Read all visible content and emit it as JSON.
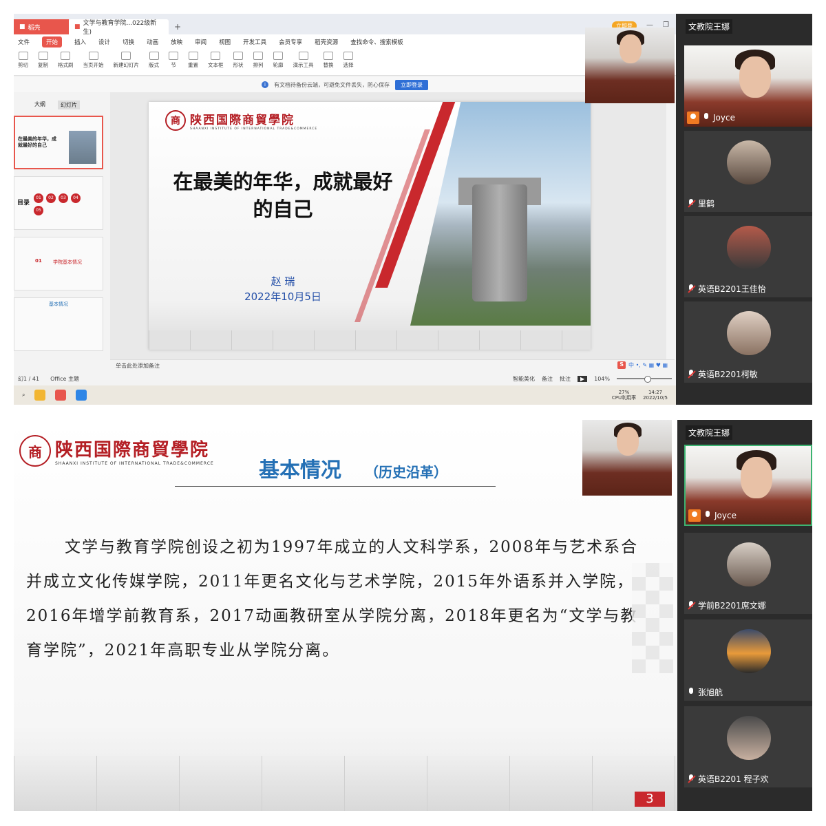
{
  "shot1": {
    "tabs": [
      {
        "label": "稻壳"
      },
      {
        "label": "文学与教育学院...022级新生)"
      }
    ],
    "tab_plus": "+",
    "login_pill": "立即登",
    "menu": [
      "文件",
      "开始",
      "插入",
      "设计",
      "切换",
      "动画",
      "放映",
      "审阅",
      "视图",
      "开发工具",
      "会员专享",
      "稻壳资源",
      "查找命令、搜索模板"
    ],
    "menu_active": "开始",
    "ribbon": [
      "剪切",
      "复制",
      "格式刷",
      "当页开始",
      "新建幻灯片",
      "版式",
      "节",
      "重置",
      "文本框",
      "形状",
      "排列",
      "轮廓",
      "演示工具",
      "替换",
      "选择"
    ],
    "infobar": {
      "text": "有文档待备份云端，可避免文件丢失，防心保存",
      "button": "立即登录"
    },
    "left_tabs": {
      "outline": "大纲",
      "slides": "幻灯片"
    },
    "thumbs": {
      "t1": "在最美的年华，成就最好的自己",
      "t2": "目录",
      "t2_items": [
        "01",
        "02",
        "03",
        "04",
        "05"
      ],
      "t3_num": "01",
      "t3": "学院基本情况",
      "t4": "基本情况"
    },
    "add_slide": "+",
    "slide": {
      "logo_seal": "商",
      "logo_cn": "陕西国際商貿學院",
      "logo_en": "SHAANXI INSTITUTE OF INTERNATIONAL TRADE&COMMERCE",
      "title": "在最美的年华，成就最好的自己",
      "author": "赵 瑞",
      "date": "2022年10月5日"
    },
    "notes": "单击此处添加备注",
    "ime": {
      "s": "S",
      "text": "中 •, ✎ ▦ ♥ ▦"
    },
    "status": {
      "page": "幻1 / 41",
      "theme": "Office 主题",
      "beautify": "智能美化",
      "notes": "备注",
      "comments": "批注",
      "zoom": "104%"
    },
    "tray": {
      "cpu": "27%",
      "cpu_label": "CPU利用率",
      "time": "14:27",
      "date": "2022/10/5"
    },
    "side_title": "文教院王娜",
    "participants": [
      {
        "name": "Joyce",
        "muted": false
      },
      {
        "name": "里鹤",
        "muted": true
      },
      {
        "name": "英语B2201王佳怡",
        "muted": true
      },
      {
        "name": "英语B2201柯敏",
        "muted": true
      }
    ]
  },
  "shot2": {
    "slide": {
      "logo_seal": "商",
      "logo_cn": "陕西国際商貿學院",
      "logo_en": "SHAANXI INSTITUTE OF INTERNATIONAL TRADE&COMMERCE",
      "title": "基本情况",
      "subtitle": "（历史沿革）",
      "body": "文学与教育学院创设之初为1997年成立的人文科学系，2008年与艺术系合并成立文化传媒学院，2011年更名文化与艺术学院，2015年外语系并入学院，2016年增学前教育系，2017动画教研室从学院分离，2018年更名为“文学与教育学院”，2021年高职专业从学院分离。",
      "page_number": "3"
    },
    "side_title": "文教院王娜",
    "participants": [
      {
        "name": "Joyce",
        "muted": false
      },
      {
        "name": "学前B2201席文娜",
        "muted": true
      },
      {
        "name": "张旭航",
        "muted": false
      },
      {
        "name": "英语B2201 程子欢",
        "muted": true
      }
    ]
  },
  "colors": {
    "brand_red": "#c9282d",
    "title_blue": "#2470b5",
    "active_green": "#3cb371"
  }
}
